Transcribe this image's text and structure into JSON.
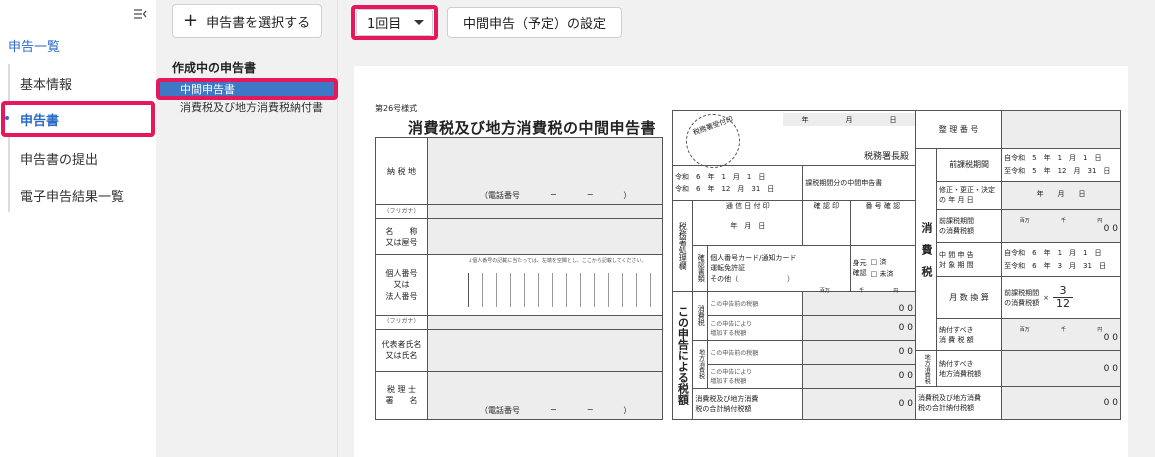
{
  "leftnav": {
    "top_label": "申告一覧",
    "items": [
      "基本情報",
      "申告書",
      "申告書の提出",
      "電子申告結果一覧"
    ],
    "active": "申告書"
  },
  "midpanel": {
    "select_button": "申告書を選択する",
    "heading": "作成中の申告書",
    "active_item": "中間申告書",
    "item2": "消費税及び地方消費税納付書"
  },
  "toolbar": {
    "round_select": "1回目",
    "setting_button": "中間申告（予定）の設定"
  },
  "form": {
    "form_no": "第26号様式",
    "title": "消費税及び地方消費税の中間申告書",
    "left": {
      "address_label": "納 税 地",
      "phone_label": "（電話番号",
      "dash": "−",
      "close_paren": "）",
      "furigana": "（フリガナ）",
      "name_label": "名　　称\n又は屋号",
      "id_label": "個人番号\n又は\n法人番号",
      "id_note": "↓個人番号の記載に当たっては、左端を空欄とし、ここから記載してください。",
      "rep_furigana": "（フリガナ）",
      "rep_label": "代表者氏名\n又は氏名",
      "tax_accountant": "税 理 士\n署　　名",
      "phone_label2": "（電話番号"
    },
    "mid": {
      "stamp": "税務署受付印",
      "year": "年",
      "month": "月",
      "day": "日",
      "office": "税務署長殿",
      "period_from": "令和　6　年　1　月　1　日",
      "period_to": "令和　6　年　12　月　31　日",
      "period_desc": "課税期間分の中間申告書",
      "proc_label": "税務署処理欄",
      "col1": "通 信 日 付 印",
      "col2": "確 認 印",
      "col3": "番 号 確 認",
      "ymd": "年　月　日",
      "confirm_doc_label": "確認書類",
      "confirm_docs": "個人番号カード/通知カード\n運転免許証\nその他（　　　　　　　）",
      "id_confirm": "身元\n確認",
      "done": "□ 済",
      "not_done": "□ 未済",
      "side_label": "この申告による税額",
      "units": [
        "百万",
        "千",
        "円"
      ],
      "consumption": "消費税",
      "row1": "この申告前の税額",
      "row2": "この申告により\n増加する税額",
      "local": "地方消費税",
      "row3": "この申告前の税額",
      "row4": "この申告により\n増加する税額",
      "total": "消費税及び地方消費\n税の合計納付税額",
      "zero": "0 0"
    },
    "right": {
      "ref_no": "整 理 番 号",
      "section": "消　費　税",
      "prev_period": "前課税期間",
      "prev_from": "自令和　5　年　1　月　1　日",
      "prev_to": "至令和　5　年　12　月　31　日",
      "amend_date": "修正・更正・決定\nの 年 月 日",
      "amend_ymd": "年　　月　　日",
      "prev_tax": "前課税期間\nの消費税額",
      "interim_period": "中 間 申 告\n対 象 期 間",
      "interim_from": "自令和　6　年　1　月　1　日",
      "interim_to": "至令和　6　年　3　月　31　日",
      "month_conv": "月 数 換 算",
      "month_formula": "前課税期間\nの消費税額",
      "times": "×",
      "numerator": "3",
      "denominator": "12",
      "due": "納付すべき\n消 費 税 額",
      "local_label": "地方消費税",
      "local_due": "納付すべき\n地方消費税額",
      "total": "消費税及び地方消費\n税の合計納付税額",
      "units": [
        "百万",
        "千",
        "円"
      ],
      "zero": "0 0"
    }
  }
}
